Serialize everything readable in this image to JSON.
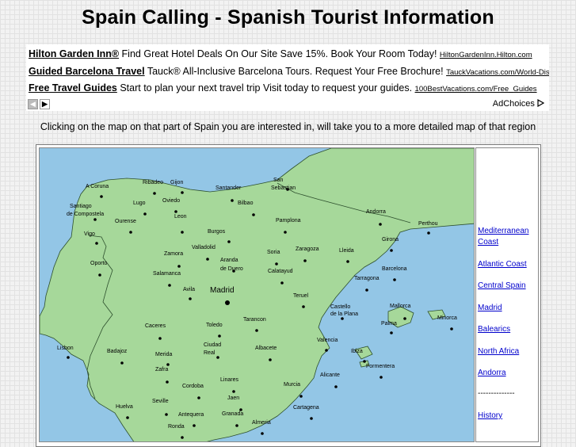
{
  "page": {
    "title": "Spain Calling - Spanish Tourist Information"
  },
  "ads": {
    "items": [
      {
        "title": "Hilton Garden Inn®",
        "text": " Find Great Hotel Deals On Our Site Save 15%. Book Your Room Today! ",
        "url": "HiltonGardenInn.Hilton.com"
      },
      {
        "title": "Guided Barcelona Travel",
        "text": " Tauck® All-Inclusive Barcelona Tours. Request Your Free Brochure! ",
        "url": "TauckVacations.com/World-Discovery"
      },
      {
        "title": "Free Travel Guides",
        "text": " Start to plan your next travel trip Visit today to request your guides. ",
        "url": "100BestVacations.com/Free_Guides"
      }
    ],
    "prev_icon": "chevron-left-icon",
    "next_icon": "chevron-right-icon",
    "adchoices_label": "AdChoices",
    "adchoices_icon": "adchoices-icon"
  },
  "intro": "Clicking on the map on that part of Spain you are interested in, will take you to a more detailed map of that region",
  "map": {
    "colors": {
      "sea": "#93c6e6",
      "land": "#a6d89a",
      "border": "#2d4f2d"
    },
    "cities": [
      "A Coruna",
      "Ribadeo",
      "Gijon",
      "Santander",
      "San",
      "Sebastian",
      "Santiago",
      "de Compostela",
      "Lugo",
      "Oviedo",
      "Bilbao",
      "Andorra",
      "Ourense",
      "Leon",
      "Pamplona",
      "Perthou",
      "Vigo",
      "Burgos",
      "Girona",
      "Oporto",
      "Zamora",
      "Valladolid",
      "Soria",
      "Zaragoza",
      "Lleida",
      "Aranda",
      "de Duero",
      "Barcelona",
      "Salamanca",
      "Calatayud",
      "Tarragona",
      "Avila",
      "Madrid",
      "Teruel",
      "Castello",
      "de la Plana",
      "Mallorca",
      "Caceres",
      "Toledo",
      "Tarancon",
      "Palma",
      "Minorca",
      "Valencia",
      "Lisbon",
      "Badajoz",
      "Merida",
      "Ciudad",
      "Real",
      "Albacete",
      "Ibiza",
      "Formentera",
      "Zafra",
      "Linares",
      "Cordoba",
      "Jaen",
      "Alicante",
      "Murcia",
      "Seville",
      "Huelva",
      "Antequera",
      "Granada",
      "Cartagena",
      "Ronda",
      "Almeria"
    ]
  },
  "sidebar": {
    "links": [
      "Mediterranean Coast",
      "Atlantic Coast",
      "Central Spain",
      "Madrid",
      "Balearics",
      "North Africa",
      "Andorra"
    ],
    "separator": "--------------",
    "history": "History"
  }
}
